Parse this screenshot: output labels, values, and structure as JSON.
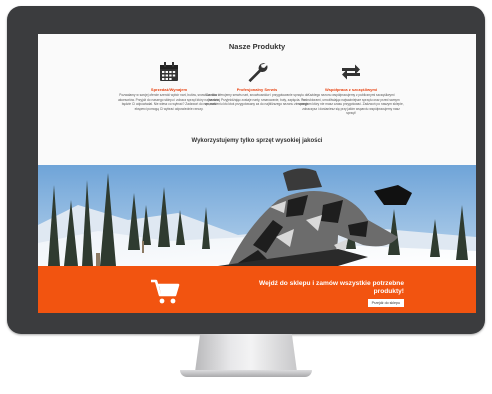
{
  "page": {
    "title": "Nasze Produkty",
    "tagline": "Wykorzystujemy tylko sprzęt wysokiej jakości"
  },
  "features": [
    {
      "icon": "calendar-icon",
      "title": "Sprzedaż/Wynajem",
      "text": "Pozwalamy w swojej ofercie szeroki wybór nart, butów, snowboardów i akcesoriów. Przyjdź do naszego sklepu i zobacz sprzęt który najbardziej będzie Ci odpowiadał. Nie wiesz co wybrać? Zadzwoń do nas, nasi eksperci pomogą Ci wybrać odpowiednie rzeczy."
    },
    {
      "icon": "wrench-icon",
      "title": "Profesjonalny Serwis",
      "text": "Co roku oferujemy serwis nart, snowboardów i przygotowanie sprzętu do sezonu. Przyjeżdżając zostaje narty, smarowanie, buty, zapięcia. Po sprawdzeniu kto ktoś przygotowany za do najbliższego sezonu zimowego."
    },
    {
      "icon": "exchange-arrows-icon",
      "title": "Współpraca z szczęśliwymi",
      "text": "Każdego sezonu współpracujemy z publicznymi szczęśliwymi instruktorami, umożliwiając najważniejsze sprzętu oraz przed samym sprzętem który nie masz czasu przygotować. Zadzwoń po naszym sklepie, zobaczysz i dostaniesz się przy jakim wsparciu współpracujemy nasz sprzęt!"
    }
  ],
  "banner": {
    "text": "Wejdź do sklepu i zamów wszystkie potrzebne produkty!",
    "button_label": "Przejdź do sklepu",
    "cart_icon": "shopping-cart-icon",
    "color": "#f25410"
  },
  "colors": {
    "accent": "#e8410f",
    "bezel": "#3b3c3e"
  }
}
